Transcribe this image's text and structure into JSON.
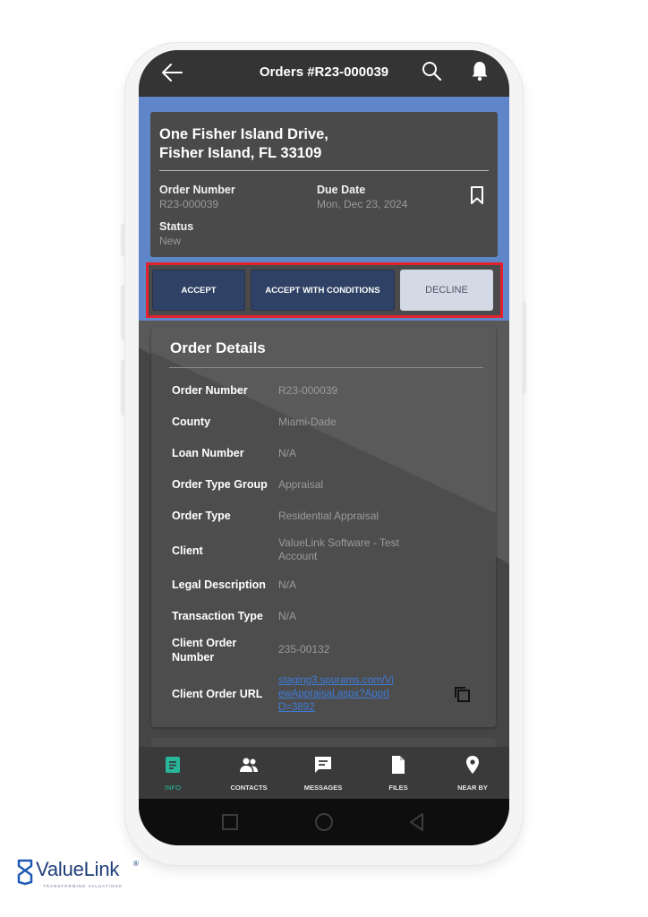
{
  "header": {
    "title": "Orders #R23-000039"
  },
  "address_card": {
    "address_line1": "One Fisher Island Drive,",
    "address_line2": "Fisher Island, FL 33109",
    "order_number_label": "Order Number",
    "order_number_value": "R23-000039",
    "due_date_label": "Due Date",
    "due_date_value": "Mon, Dec 23, 2024",
    "status_label": "Status",
    "status_value": "New"
  },
  "actions": {
    "accept": "ACCEPT",
    "accept_with_conditions": "ACCEPT WITH CONDITIONS",
    "decline": "DECLINE"
  },
  "order_details": {
    "title": "Order Details",
    "rows": [
      {
        "label": "Order Number",
        "value": "R23-000039"
      },
      {
        "label": "County",
        "value": "Miami-Dade"
      },
      {
        "label": "Loan Number",
        "value": "N/A"
      },
      {
        "label": "Order Type Group",
        "value": "Appraisal"
      },
      {
        "label": "Order Type",
        "value": "Residential Appraisal"
      },
      {
        "label": "Client",
        "value": "ValueLink Software - Test Account"
      },
      {
        "label": "Legal Description",
        "value": "N/A"
      },
      {
        "label": "Transaction Type",
        "value": "N/A"
      },
      {
        "label": "Client Order Number",
        "value": "235-00132"
      },
      {
        "label": "Client Order URL",
        "value": "staging3.spurams.com/ViewAppraisal.aspx?ApprID=3892"
      }
    ]
  },
  "bottom_nav": {
    "items": [
      {
        "label": "INFO",
        "icon": "info-doc-icon",
        "active": true
      },
      {
        "label": "CONTACTS",
        "icon": "people-icon",
        "active": false
      },
      {
        "label": "MESSAGES",
        "icon": "message-icon",
        "active": false
      },
      {
        "label": "FILES",
        "icon": "file-icon",
        "active": false
      },
      {
        "label": "NEAR BY",
        "icon": "location-pin-icon",
        "active": false
      }
    ]
  },
  "brand": {
    "name": "ValueLink",
    "registered": "®",
    "tagline": "TRANSFORMING VALUATIONS"
  },
  "colors": {
    "header_bg": "#343434",
    "blue_band": "#5f86c8",
    "highlight_border": "#e2232e",
    "primary_button": "#2f4266",
    "decline_button": "#d4d9e6",
    "active_nav": "#27b79a",
    "link": "#3d7bd9",
    "brand": "#1f3d7a"
  }
}
